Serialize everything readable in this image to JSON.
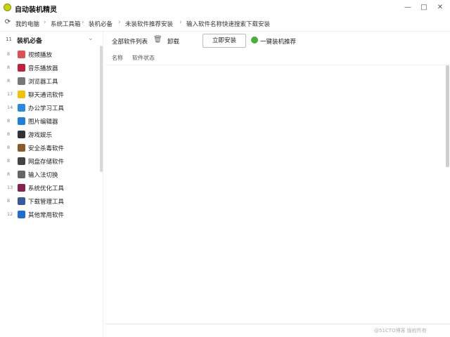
{
  "window": {
    "title": "自动装机精灵",
    "minimize_glyph": "—",
    "maximize_glyph": "□",
    "close_glyph": "✕",
    "logo_color": "#c8d400"
  },
  "nav": {
    "back_glyph": "⟳",
    "breadcrumbs": [
      {
        "label": "我的电脑"
      },
      {
        "label": "系统工具箱"
      },
      {
        "label": "装机必备"
      },
      {
        "label": "未装软件推荐安装"
      },
      {
        "label": "输入软件名称快速搜索下载安装"
      }
    ],
    "separator": "›"
  },
  "sidebar": {
    "header_num": "11",
    "header_label": "装机必备",
    "chevron": "⌄",
    "items": [
      {
        "num": "8",
        "label": "视频播放",
        "icon_color": "#e05050"
      },
      {
        "num": "8",
        "label": "音乐播放器",
        "icon_color": "#c02040"
      },
      {
        "num": "8",
        "label": "浏览器工具",
        "icon_color": "#777777"
      },
      {
        "num": "17",
        "label": "聊天通讯软件",
        "icon_color": "#f2c200"
      },
      {
        "num": "14",
        "label": "办公学习工具",
        "icon_color": "#2a8ae0"
      },
      {
        "num": "8",
        "label": "图片编辑器",
        "icon_color": "#1f7fd9"
      },
      {
        "num": "8",
        "label": "游戏娱乐",
        "icon_color": "#333333"
      },
      {
        "num": "8",
        "label": "安全杀毒软件",
        "icon_color": "#8a5a2a"
      },
      {
        "num": "8",
        "label": "网盘存储软件",
        "icon_color": "#444444"
      },
      {
        "num": "8",
        "label": "输入法切换",
        "icon_color": "#666666"
      },
      {
        "num": "13",
        "label": "系统优化工具",
        "icon_color": "#8a2050"
      },
      {
        "num": "8",
        "label": "下载管理工具",
        "icon_color": "#3a5aa0"
      },
      {
        "num": "12",
        "label": "其他常用软件",
        "icon_color": "#1e6fd0"
      }
    ]
  },
  "toolbar": {
    "left_label": "全部软件列表",
    "icon_label": "卸载",
    "button_label": "立即安装",
    "green_label": "一键装机推荐"
  },
  "subbar": {
    "col1": "名称",
    "col2": "软件状态"
  },
  "footer": {
    "watermark": "@51CTO博客 版权所有"
  }
}
